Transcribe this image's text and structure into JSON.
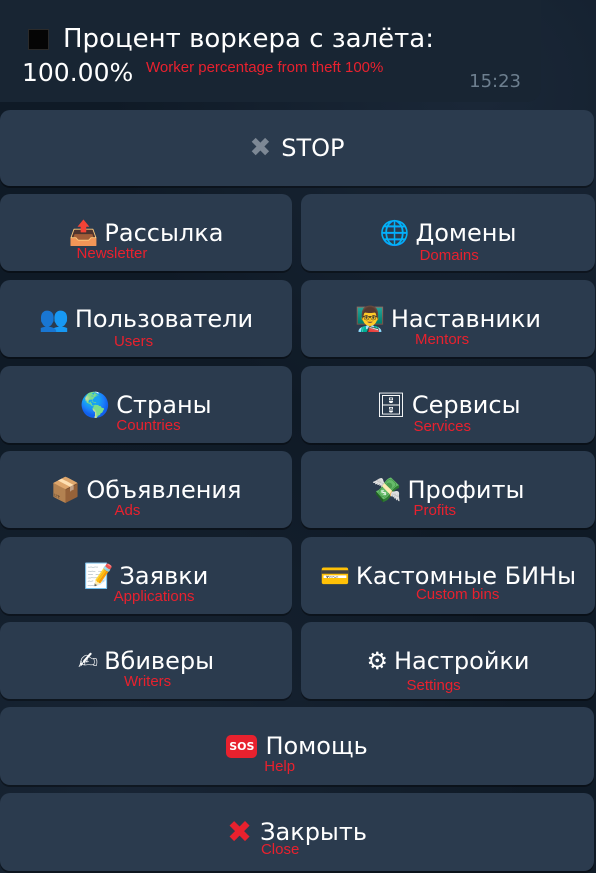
{
  "message": {
    "title": "Процент воркера с залёта:",
    "value": "100.00%",
    "annotation": "Worker percentage from theft 100%",
    "time": "15:23"
  },
  "keyboard": {
    "stop": {
      "icon": "✖",
      "label": "STOP"
    },
    "newsletter": {
      "icon": "📤",
      "label": "Рассылка",
      "sub": "Newsletter"
    },
    "domains": {
      "icon": "🌐",
      "label": "Домены",
      "sub": "Domains"
    },
    "users": {
      "icon": "👥",
      "label": "Пользователи",
      "sub": "Users"
    },
    "mentors": {
      "icon": "👨‍🏫",
      "label": "Наставники",
      "sub": "Mentors"
    },
    "countries": {
      "icon": "🌎",
      "label": "Страны",
      "sub": "Countries"
    },
    "services": {
      "icon": "🗄",
      "label": "Сервисы",
      "sub": "Services"
    },
    "ads": {
      "icon": "📦",
      "label": "Объявления",
      "sub": "Ads"
    },
    "profits": {
      "icon": "💸",
      "label": "Профиты",
      "sub": "Profits"
    },
    "applications": {
      "icon": "📝",
      "label": "Заявки",
      "sub": "Applications"
    },
    "custom_bins": {
      "icon": "💳",
      "label": "Кастомные БИНы",
      "sub": "Custom bins"
    },
    "writers": {
      "icon": "✍",
      "label": "Вбиверы",
      "sub": "Writers"
    },
    "settings": {
      "icon": "⚙",
      "label": "Настройки",
      "sub": "Settings"
    },
    "help": {
      "icon": "SOS",
      "label": "Помощь",
      "sub": "Help"
    },
    "close": {
      "icon": "✖",
      "label": "Закрыть",
      "sub": "Close"
    }
  }
}
